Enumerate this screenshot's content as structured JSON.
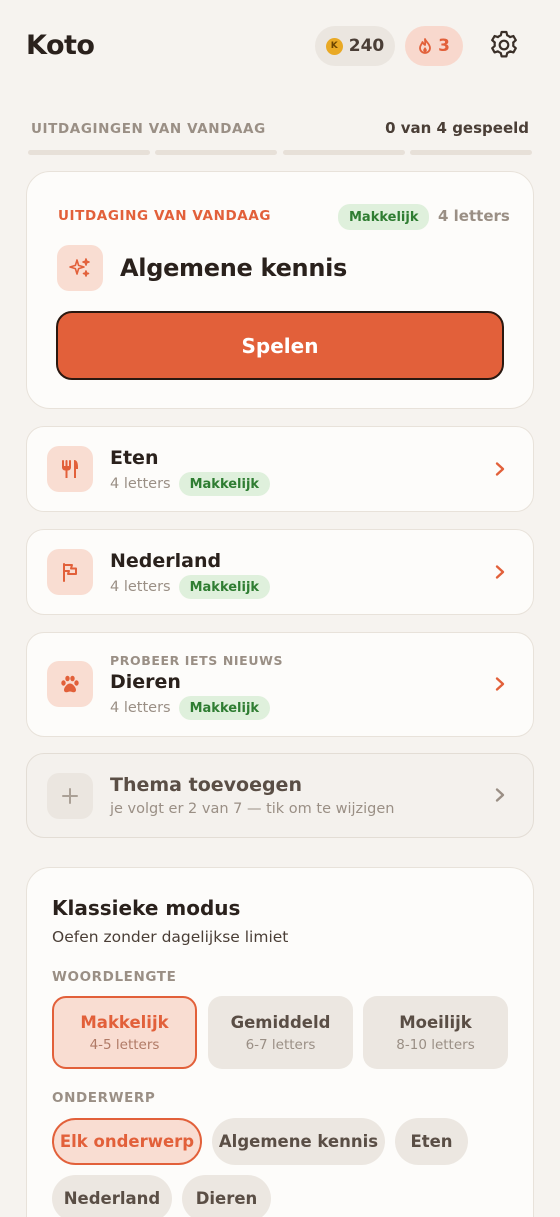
{
  "header": {
    "app_name": "Koto",
    "coins": "240",
    "coin_symbol": "K",
    "streak": "3"
  },
  "progress": {
    "label": "UITDAGINGEN VAN VANDAAG",
    "count": "0 van 4 gespeeld",
    "played": 0,
    "total": 4
  },
  "challenge": {
    "kicker": "UITDAGING VAN VANDAAG",
    "difficulty": "Makkelijk",
    "letters": "4 letters",
    "title": "Algemene kennis",
    "icon": "sparkles-icon",
    "play_label": "Spelen"
  },
  "topics": [
    {
      "title": "Eten",
      "letters": "4 letters",
      "difficulty": "Makkelijk",
      "icon": "fork-knife-icon"
    },
    {
      "title": "Nederland",
      "letters": "4 letters",
      "difficulty": "Makkelijk",
      "icon": "flag-icon"
    },
    {
      "kicker": "PROBEER IETS NIEUWS",
      "title": "Dieren",
      "letters": "4 letters",
      "difficulty": "Makkelijk",
      "icon": "paw-icon"
    }
  ],
  "add_theme": {
    "title": "Thema toevoegen",
    "subtitle": "je volgt er 2 van 7 — tik om te wijzigen"
  },
  "classic": {
    "title": "Klassieke modus",
    "subtitle": "Oefen zonder dagelijkse limiet",
    "length_label": "WOORDLENGTE",
    "lengths": [
      {
        "title": "Makkelijk",
        "range": "4-5 letters",
        "selected": true
      },
      {
        "title": "Gemiddeld",
        "range": "6-7 letters",
        "selected": false
      },
      {
        "title": "Moeilijk",
        "range": "8-10 letters",
        "selected": false
      }
    ],
    "subject_label": "ONDERWERP",
    "subjects": [
      "Elk onderwerp",
      "Algemene kennis",
      "Eten",
      "Nederland",
      "Dieren"
    ],
    "selected_subject": "Elk onderwerp"
  },
  "colors": {
    "accent": "#e2603a",
    "accent_soft": "#f9ddd2",
    "easy_badge_bg": "#dff0dc",
    "easy_badge_text": "#2f7d32",
    "background": "#f6f3ef"
  }
}
